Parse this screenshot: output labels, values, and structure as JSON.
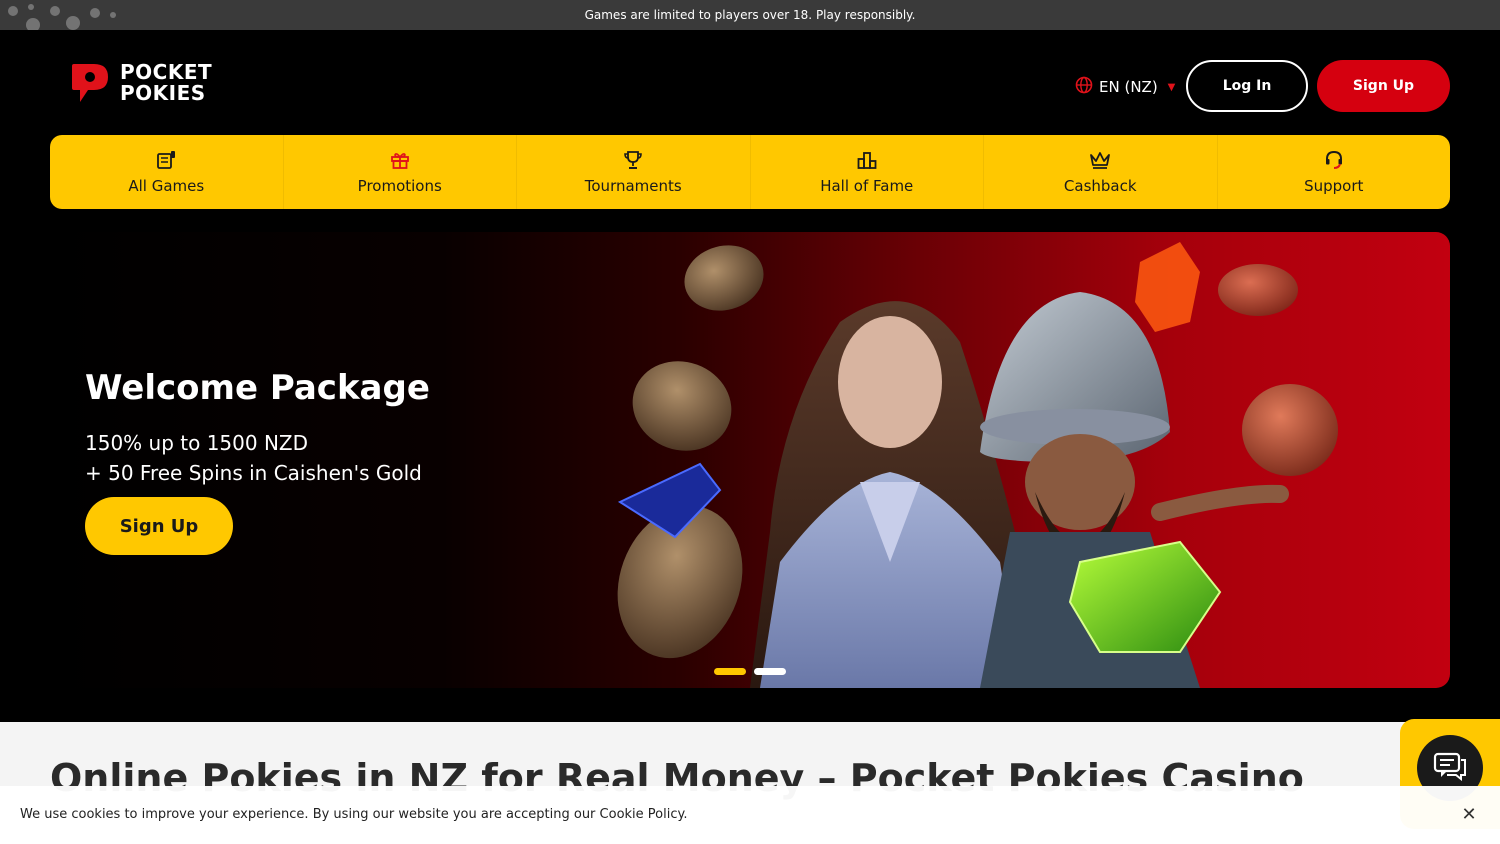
{
  "topbar": {
    "notice": "Games are limited to players over 18. Play responsibly."
  },
  "header": {
    "logo_line1": "POCKET",
    "logo_line2": "POKIES",
    "language": "EN (NZ)",
    "login_label": "Log In",
    "signup_label": "Sign Up"
  },
  "nav": {
    "items": [
      {
        "label": "All Games",
        "icon": "games-icon"
      },
      {
        "label": "Promotions",
        "icon": "gift-icon"
      },
      {
        "label": "Tournaments",
        "icon": "trophy-icon"
      },
      {
        "label": "Hall of Fame",
        "icon": "podium-icon"
      },
      {
        "label": "Cashback",
        "icon": "crown-icon"
      },
      {
        "label": "Support",
        "icon": "headset-icon"
      }
    ]
  },
  "hero": {
    "title": "Welcome Package",
    "line1": "150% up to 1500 NZD",
    "line2": "+ 50 Free Spins in Caishen's Gold",
    "cta_label": "Sign Up",
    "slides": 2,
    "active_slide": 1
  },
  "content": {
    "title": "Online Pokies in NZ for Real Money – Pocket Pokies Casino"
  },
  "cookie": {
    "text": "We use cookies to improve your experience. By using our website you are accepting our Cookie Policy."
  },
  "colors": {
    "accent_yellow": "#ffc800",
    "brand_red": "#d5000f",
    "background": "#000000"
  }
}
